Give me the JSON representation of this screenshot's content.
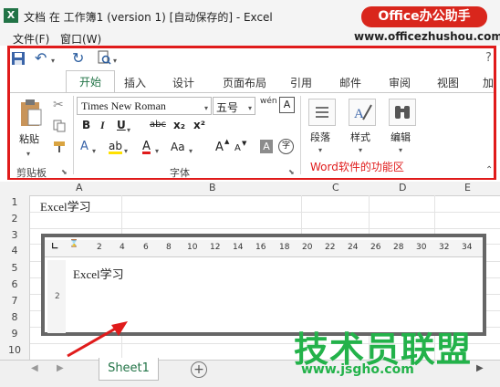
{
  "window": {
    "app_icon": "X",
    "title": "文档 在 工作簿1 (version 1) [自动保存的] - Excel",
    "watermark_badge": "Office办公助手",
    "watermark_url": "www.officezhushou.com"
  },
  "menu": {
    "items": [
      "文件(F)",
      "窗口(W)"
    ]
  },
  "qat": {
    "help": "?"
  },
  "ribbon": {
    "tabs": [
      "开始",
      "插入",
      "设计",
      "页面布局",
      "引用",
      "邮件",
      "审阅",
      "视图",
      "加"
    ],
    "clipboard": {
      "paste_label": "粘贴",
      "group_label": "剪贴板"
    },
    "font": {
      "font_name": "Times New Roman",
      "font_size": "五号",
      "pinyin_label": "wén",
      "bold": "B",
      "italic": "I",
      "underline": "U",
      "strike": "abc",
      "sub": "x₂",
      "sup": "x²",
      "grow": "A",
      "shrink": "A",
      "highlight": "ab",
      "color": "A",
      "case": "Aa",
      "clear": "A",
      "phonetic": "字",
      "group_label": "字体"
    },
    "paragraph": {
      "label": "段落"
    },
    "styles": {
      "label": "样式"
    },
    "editing": {
      "label": "编辑"
    },
    "caption": "Word软件的功能区"
  },
  "sheet": {
    "columns": [
      "A",
      "B",
      "C",
      "D",
      "E"
    ],
    "rows": [
      "1",
      "2",
      "3",
      "4",
      "5",
      "6",
      "7",
      "8",
      "9",
      "10"
    ],
    "a1": "Excel学习",
    "embedded_text": "Excel学习",
    "ruler_ticks": [
      "2",
      "4",
      "6",
      "8",
      "10",
      "12",
      "14",
      "16",
      "18",
      "20",
      "22",
      "24",
      "26",
      "28",
      "30",
      "32",
      "34"
    ],
    "tab_label": "Sheet1"
  },
  "watermark": {
    "big": "技术员联盟",
    "url": "www.jsgho.com"
  },
  "colors": {
    "accent": "#217346",
    "highlight_frame": "#e01b1b",
    "watermark_green": "#23b24a"
  }
}
